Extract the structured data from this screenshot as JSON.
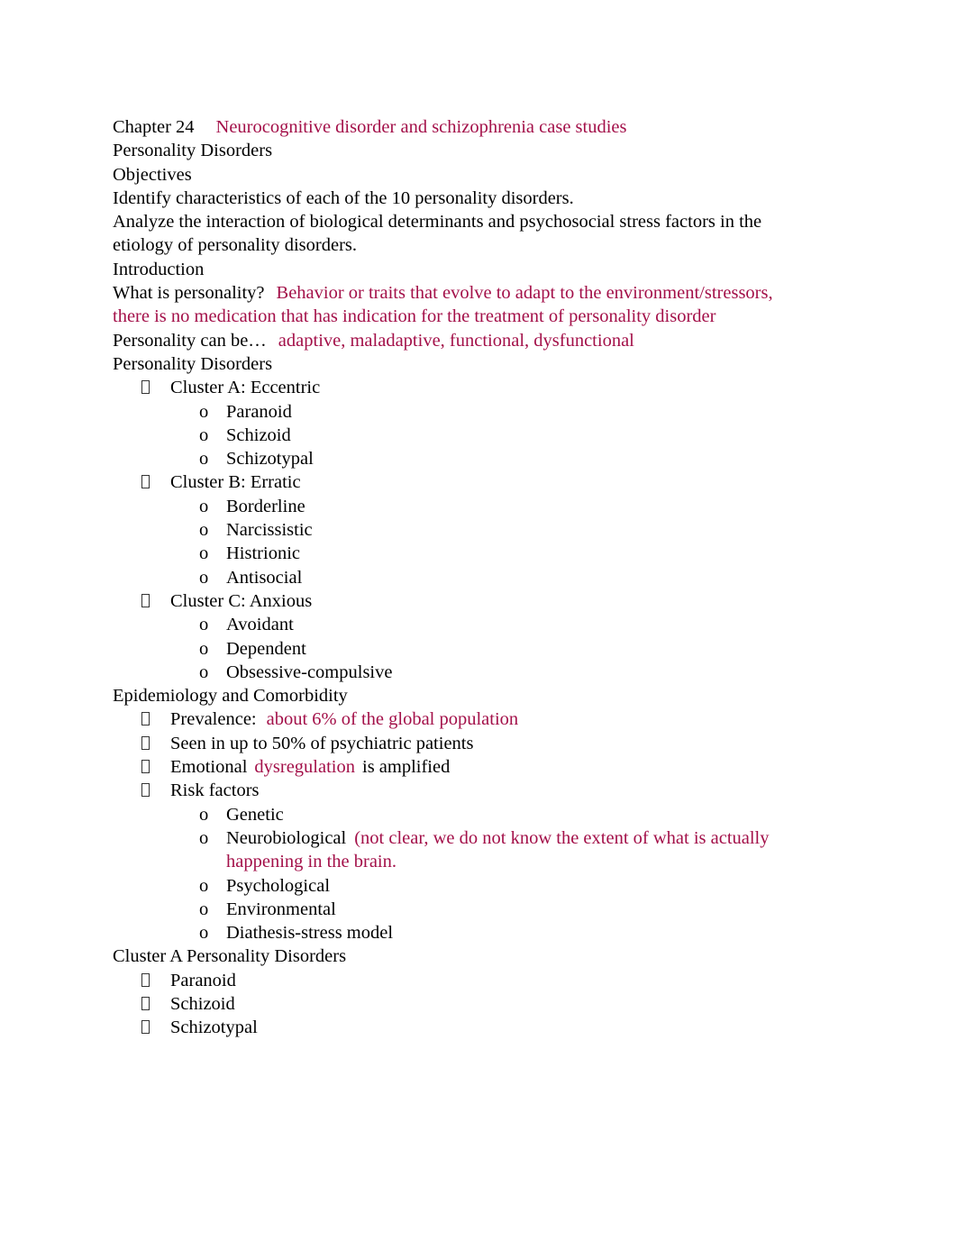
{
  "document": {
    "title_line": {
      "label": "Chapter 24",
      "title": "Neurocognitive disorder and schizophrenia case studies"
    },
    "heading_personality_disorders_1": "Personality Disorders",
    "heading_objectives": "Objectives",
    "objective_1": "Identify characteristics of each of the 10 personality disorders.",
    "objective_2": "Analyze the interaction of biological determinants and psychosocial stress factors in the etiology of personality disorders.",
    "heading_introduction": "Introduction",
    "what_is_personality": {
      "question": "What is personality?",
      "answer": "Behavior or traits that evolve to adapt to the environment/stressors, there is no medication that has indication for the treatment of personality disorder"
    },
    "personality_can_be": {
      "prompt": "Personality can be…",
      "answer": "adaptive, maladaptive, functional, dysfunctional"
    },
    "heading_personality_disorders_2": "Personality Disorders",
    "clusters": [
      {
        "label": "Cluster A: Eccentric",
        "items": [
          "Paranoid",
          "Schizoid",
          "Schizotypal"
        ]
      },
      {
        "label": "Cluster B: Erratic",
        "items": [
          "Borderline",
          "Narcissistic",
          "Histrionic",
          "Antisocial"
        ]
      },
      {
        "label": "Cluster C: Anxious",
        "items": [
          "Avoidant",
          "Dependent",
          "Obsessive-compulsive"
        ]
      }
    ],
    "heading_epidemiology": "Epidemiology and Comorbidity",
    "epidemiology": {
      "prevalence_label": "Prevalence:",
      "prevalence_value": "about 6% of the global population",
      "psychiatric_patients": "Seen in up to 50% of psychiatric patients",
      "emotional_prefix": "Emotional",
      "emotional_highlight": "dysregulation",
      "emotional_suffix": "is amplified",
      "risk_factors_label": "Risk factors",
      "risk_factors": [
        {
          "text": "Genetic",
          "note": ""
        },
        {
          "text": "Neurobiological",
          "note": "(not clear, we do not know the extent of what is actually happening in the brain."
        },
        {
          "text": "Psychological",
          "note": ""
        },
        {
          "text": "Environmental",
          "note": ""
        },
        {
          "text": "Diathesis-stress model",
          "note": ""
        }
      ]
    },
    "heading_cluster_a": "Cluster A Personality Disorders",
    "cluster_a_items": [
      "Paranoid",
      "Schizoid",
      "Schizotypal"
    ],
    "colors": {
      "body_text": "#000000",
      "highlight_text": "#A31049",
      "page_background": "#FFFFFF"
    }
  }
}
